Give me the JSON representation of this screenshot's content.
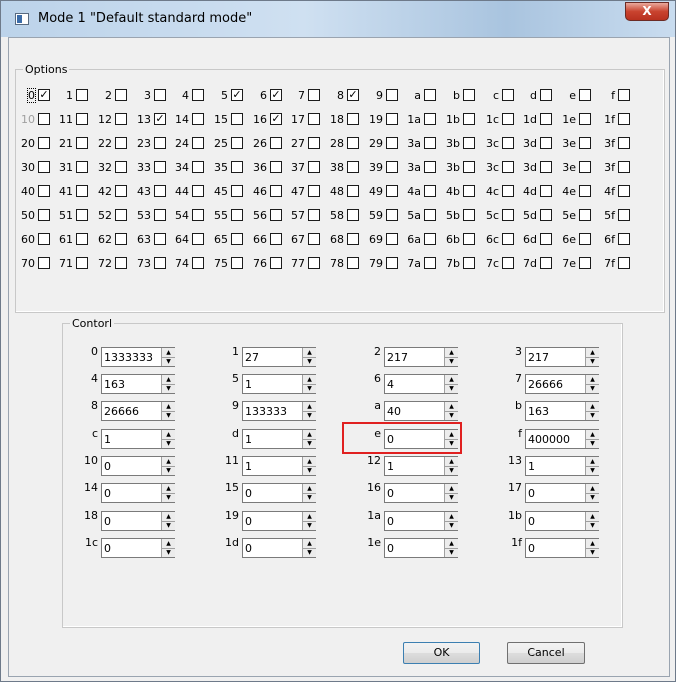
{
  "window": {
    "title": "Mode 1 \"Default standard mode\"",
    "close_glyph": "X"
  },
  "options": {
    "legend": "Options",
    "rows": [
      [
        {
          "label": "0",
          "checked": true,
          "focus": true
        },
        {
          "label": "1",
          "checked": false
        },
        {
          "label": "2",
          "checked": false
        },
        {
          "label": "3",
          "checked": false
        },
        {
          "label": "4",
          "checked": false
        },
        {
          "label": "5",
          "checked": true
        },
        {
          "label": "6",
          "checked": true
        },
        {
          "label": "7",
          "checked": false
        },
        {
          "label": "8",
          "checked": true
        },
        {
          "label": "9",
          "checked": false
        },
        {
          "label": "a",
          "checked": false
        },
        {
          "label": "b",
          "checked": false
        },
        {
          "label": "c",
          "checked": false
        },
        {
          "label": "d",
          "checked": false
        },
        {
          "label": "e",
          "checked": false
        },
        {
          "label": "f",
          "checked": false
        }
      ],
      [
        {
          "label": "10",
          "checked": false,
          "disabled": true
        },
        {
          "label": "11",
          "checked": false
        },
        {
          "label": "12",
          "checked": false
        },
        {
          "label": "13",
          "checked": true
        },
        {
          "label": "14",
          "checked": false
        },
        {
          "label": "15",
          "checked": false
        },
        {
          "label": "16",
          "checked": true
        },
        {
          "label": "17",
          "checked": false
        },
        {
          "label": "18",
          "checked": false
        },
        {
          "label": "19",
          "checked": false
        },
        {
          "label": "1a",
          "checked": false
        },
        {
          "label": "1b",
          "checked": false
        },
        {
          "label": "1c",
          "checked": false
        },
        {
          "label": "1d",
          "checked": false
        },
        {
          "label": "1e",
          "checked": false
        },
        {
          "label": "1f",
          "checked": false
        }
      ],
      [
        {
          "label": "20",
          "checked": false
        },
        {
          "label": "21",
          "checked": false
        },
        {
          "label": "22",
          "checked": false
        },
        {
          "label": "23",
          "checked": false
        },
        {
          "label": "24",
          "checked": false
        },
        {
          "label": "25",
          "checked": false
        },
        {
          "label": "26",
          "checked": false
        },
        {
          "label": "27",
          "checked": false
        },
        {
          "label": "28",
          "checked": false
        },
        {
          "label": "29",
          "checked": false
        },
        {
          "label": "3a",
          "checked": false
        },
        {
          "label": "3b",
          "checked": false
        },
        {
          "label": "3c",
          "checked": false
        },
        {
          "label": "3d",
          "checked": false
        },
        {
          "label": "3e",
          "checked": false
        },
        {
          "label": "3f",
          "checked": false
        }
      ],
      [
        {
          "label": "30",
          "checked": false
        },
        {
          "label": "31",
          "checked": false
        },
        {
          "label": "32",
          "checked": false
        },
        {
          "label": "33",
          "checked": false
        },
        {
          "label": "34",
          "checked": false
        },
        {
          "label": "35",
          "checked": false
        },
        {
          "label": "36",
          "checked": false
        },
        {
          "label": "37",
          "checked": false
        },
        {
          "label": "38",
          "checked": false
        },
        {
          "label": "39",
          "checked": false
        },
        {
          "label": "3a",
          "checked": false
        },
        {
          "label": "3b",
          "checked": false
        },
        {
          "label": "3c",
          "checked": false
        },
        {
          "label": "3d",
          "checked": false
        },
        {
          "label": "3e",
          "checked": false
        },
        {
          "label": "3f",
          "checked": false
        }
      ],
      [
        {
          "label": "40",
          "checked": false
        },
        {
          "label": "41",
          "checked": false
        },
        {
          "label": "42",
          "checked": false
        },
        {
          "label": "43",
          "checked": false
        },
        {
          "label": "44",
          "checked": false
        },
        {
          "label": "45",
          "checked": false
        },
        {
          "label": "46",
          "checked": false
        },
        {
          "label": "47",
          "checked": false
        },
        {
          "label": "48",
          "checked": false
        },
        {
          "label": "49",
          "checked": false
        },
        {
          "label": "4a",
          "checked": false
        },
        {
          "label": "4b",
          "checked": false
        },
        {
          "label": "4c",
          "checked": false
        },
        {
          "label": "4d",
          "checked": false
        },
        {
          "label": "4e",
          "checked": false
        },
        {
          "label": "4f",
          "checked": false
        }
      ],
      [
        {
          "label": "50",
          "checked": false
        },
        {
          "label": "51",
          "checked": false
        },
        {
          "label": "52",
          "checked": false
        },
        {
          "label": "53",
          "checked": false
        },
        {
          "label": "54",
          "checked": false
        },
        {
          "label": "55",
          "checked": false
        },
        {
          "label": "56",
          "checked": false
        },
        {
          "label": "57",
          "checked": false
        },
        {
          "label": "58",
          "checked": false
        },
        {
          "label": "59",
          "checked": false
        },
        {
          "label": "5a",
          "checked": false
        },
        {
          "label": "5b",
          "checked": false
        },
        {
          "label": "5c",
          "checked": false
        },
        {
          "label": "5d",
          "checked": false
        },
        {
          "label": "5e",
          "checked": false
        },
        {
          "label": "5f",
          "checked": false
        }
      ],
      [
        {
          "label": "60",
          "checked": false
        },
        {
          "label": "61",
          "checked": false
        },
        {
          "label": "62",
          "checked": false
        },
        {
          "label": "63",
          "checked": false
        },
        {
          "label": "64",
          "checked": false
        },
        {
          "label": "65",
          "checked": false
        },
        {
          "label": "66",
          "checked": false
        },
        {
          "label": "67",
          "checked": false
        },
        {
          "label": "68",
          "checked": false
        },
        {
          "label": "69",
          "checked": false
        },
        {
          "label": "6a",
          "checked": false
        },
        {
          "label": "6b",
          "checked": false
        },
        {
          "label": "6c",
          "checked": false
        },
        {
          "label": "6d",
          "checked": false
        },
        {
          "label": "6e",
          "checked": false
        },
        {
          "label": "6f",
          "checked": false
        }
      ],
      [
        {
          "label": "70",
          "checked": false
        },
        {
          "label": "71",
          "checked": false
        },
        {
          "label": "72",
          "checked": false
        },
        {
          "label": "73",
          "checked": false
        },
        {
          "label": "74",
          "checked": false
        },
        {
          "label": "75",
          "checked": false
        },
        {
          "label": "76",
          "checked": false
        },
        {
          "label": "77",
          "checked": false
        },
        {
          "label": "78",
          "checked": false
        },
        {
          "label": "79",
          "checked": false
        },
        {
          "label": "7a",
          "checked": false
        },
        {
          "label": "7b",
          "checked": false
        },
        {
          "label": "7c",
          "checked": false
        },
        {
          "label": "7d",
          "checked": false
        },
        {
          "label": "7e",
          "checked": false
        },
        {
          "label": "7f",
          "checked": false
        }
      ]
    ]
  },
  "control": {
    "legend": "Contorl",
    "fields": [
      {
        "label": "0",
        "value": "1333333"
      },
      {
        "label": "1",
        "value": "27"
      },
      {
        "label": "2",
        "value": "217"
      },
      {
        "label": "3",
        "value": "217"
      },
      {
        "label": "4",
        "value": "163"
      },
      {
        "label": "5",
        "value": "1"
      },
      {
        "label": "6",
        "value": "4"
      },
      {
        "label": "7",
        "value": "26666"
      },
      {
        "label": "8",
        "value": "26666"
      },
      {
        "label": "9",
        "value": "133333"
      },
      {
        "label": "a",
        "value": "40"
      },
      {
        "label": "b",
        "value": "163"
      },
      {
        "label": "c",
        "value": "1"
      },
      {
        "label": "d",
        "value": "1"
      },
      {
        "label": "e",
        "value": "0",
        "highlighted": true
      },
      {
        "label": "f",
        "value": "400000"
      },
      {
        "label": "10",
        "value": "0"
      },
      {
        "label": "11",
        "value": "1"
      },
      {
        "label": "12",
        "value": "1"
      },
      {
        "label": "13",
        "value": "1"
      },
      {
        "label": "14",
        "value": "0"
      },
      {
        "label": "15",
        "value": "0"
      },
      {
        "label": "16",
        "value": "0"
      },
      {
        "label": "17",
        "value": "0"
      },
      {
        "label": "18",
        "value": "0"
      },
      {
        "label": "19",
        "value": "0"
      },
      {
        "label": "1a",
        "value": "0"
      },
      {
        "label": "1b",
        "value": "0"
      },
      {
        "label": "1c",
        "value": "0"
      },
      {
        "label": "1d",
        "value": "0"
      },
      {
        "label": "1e",
        "value": "0"
      },
      {
        "label": "1f",
        "value": "0"
      }
    ]
  },
  "buttons": {
    "ok_label": "OK",
    "cancel_label": "Cancel"
  },
  "colors": {
    "highlight": "#e02020",
    "disabled_text": "#a0a0a0"
  }
}
